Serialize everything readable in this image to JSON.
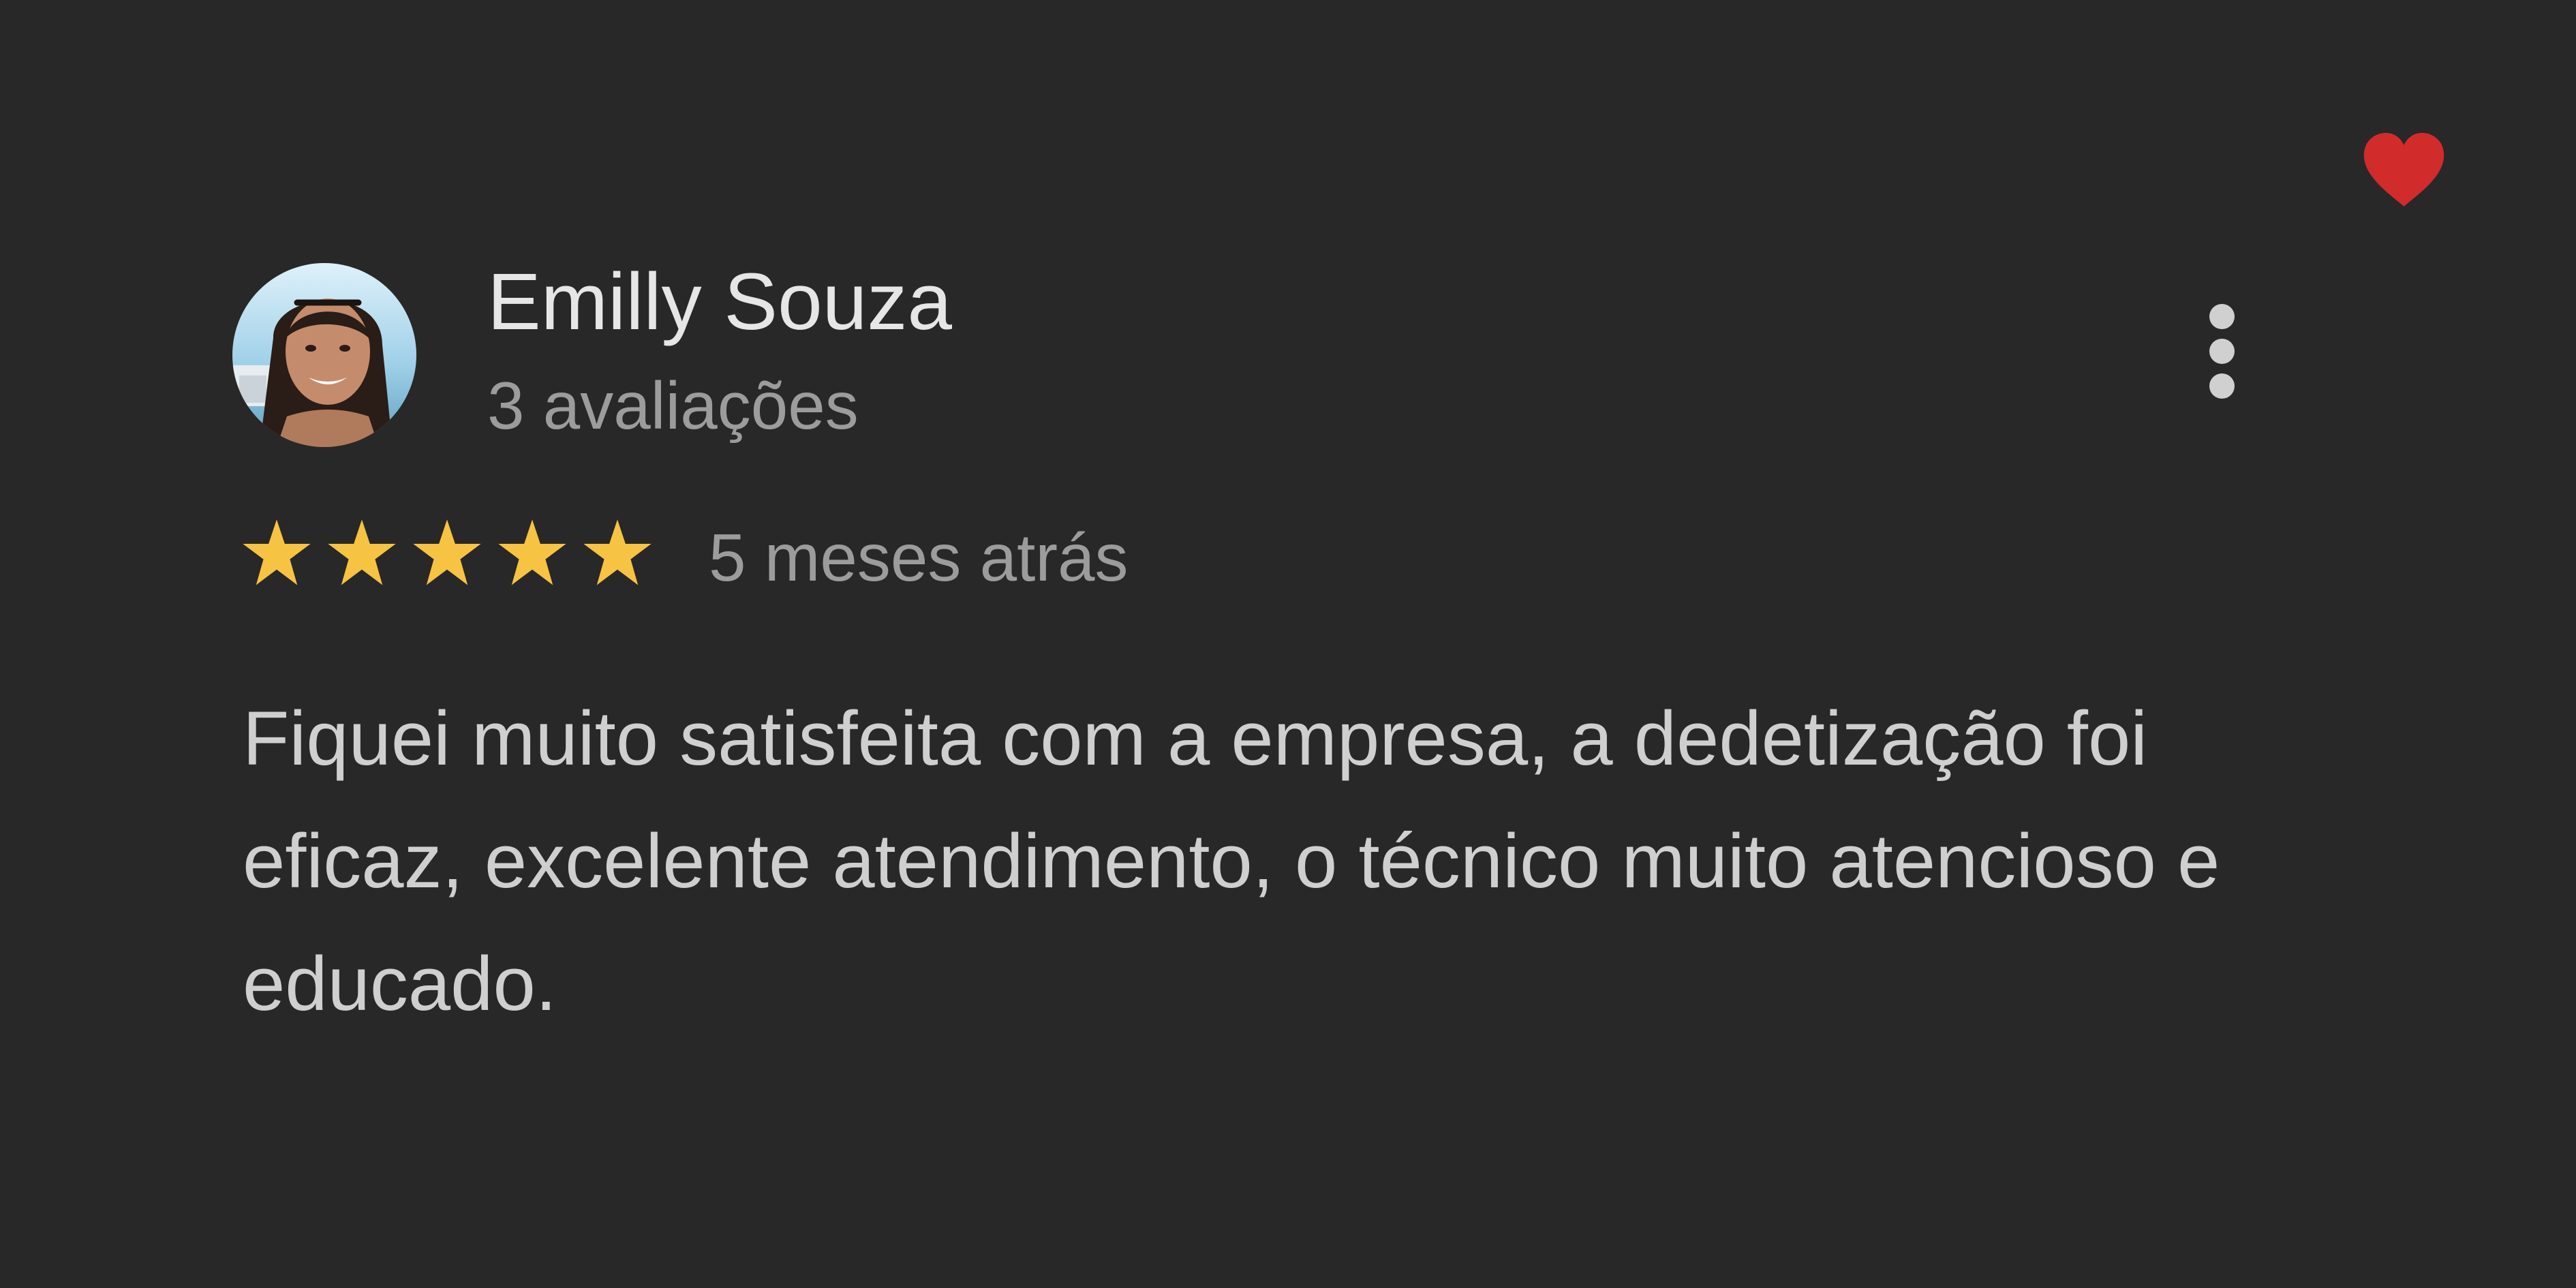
{
  "review": {
    "reviewer_name": "Emilly Souza",
    "review_count": "3 avaliações",
    "rating": 5,
    "rating_max": 5,
    "date": "5 meses atrás",
    "text": "Fiquei muito satisfeita com a empresa, a dedetização foi eficaz, excelente atendimento, o técnico muito atencioso e educado."
  },
  "icons": {
    "avatar": "profile-photo",
    "more": "more-vertical-icon",
    "favorite": "heart-icon",
    "star": "star-icon"
  },
  "colors": {
    "background": "#282828",
    "star": "#f6c343",
    "heart": "#d12b2b",
    "name": "#e6e6e6",
    "secondary_text": "#9c9c9c",
    "body_text": "#cfcfcf"
  }
}
